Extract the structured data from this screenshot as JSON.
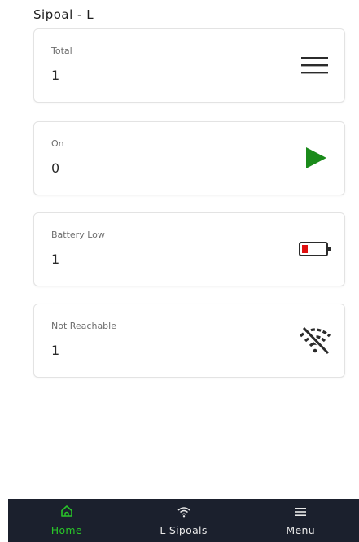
{
  "header": {
    "title": "Sipoal - L"
  },
  "cards": [
    {
      "label": "Total",
      "value": "1",
      "icon": "list-icon"
    },
    {
      "label": "On",
      "value": "0",
      "icon": "play-icon"
    },
    {
      "label": "Battery Low",
      "value": "1",
      "icon": "battery-low-icon"
    },
    {
      "label": "Not Reachable",
      "value": "1",
      "icon": "wifi-off-icon"
    }
  ],
  "nav": {
    "items": [
      {
        "label": "Home",
        "icon": "home-icon",
        "active": true
      },
      {
        "label": "L Sipoals",
        "icon": "wifi-icon",
        "active": false
      },
      {
        "label": "Menu",
        "icon": "menu-icon",
        "active": false
      }
    ]
  },
  "colors": {
    "accent_green": "#29c529",
    "play_green": "#1a8a1a",
    "battery_red": "#e01010",
    "nav_bg": "#1b202d",
    "card_border": "#e3e3e3"
  }
}
